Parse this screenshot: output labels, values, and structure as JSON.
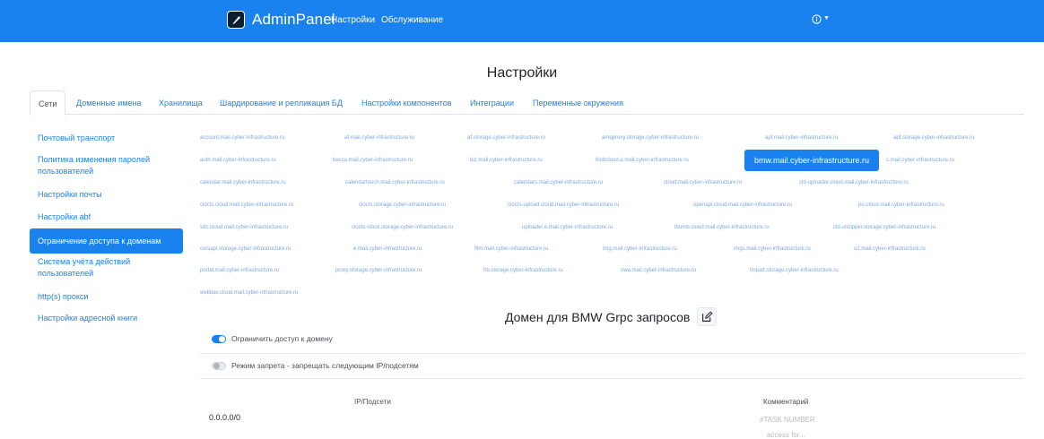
{
  "header": {
    "brand": "AdminPanel",
    "nav": [
      "Настройки",
      "Обслуживание"
    ],
    "accent": "#1a82ef"
  },
  "page": {
    "title": "Настройки"
  },
  "tabs": [
    {
      "label": "Сети",
      "active": true
    },
    {
      "label": "Доменные имена"
    },
    {
      "label": "Хранилища"
    },
    {
      "label": "Шардирование и репликация БД"
    },
    {
      "label": "Настройки компонентов"
    },
    {
      "label": "Интеграции"
    },
    {
      "label": "Переменные окружения"
    }
  ],
  "sidebar": {
    "items": [
      {
        "label": "Почтовый транспорт"
      },
      {
        "label": "Политика изменения паролей пользователей"
      },
      {
        "label": "Настройки почты"
      },
      {
        "label": "Настройки abf"
      },
      {
        "label": "Ограничение доступа к доменам",
        "active": true
      },
      {
        "label": "Система учёта действий пользователей"
      },
      {
        "label": "http(s) прокси"
      },
      {
        "label": "Настройки адресной книги"
      }
    ]
  },
  "domains": {
    "rows": [
      [
        "account.mail.cyber-infrastructure.ru",
        "af.mail.cyber-infrastructure.ru",
        "af.storage.cyber-infrastructure.ru",
        "amqproxy.storage.cyber-infrastructure.ru",
        "apf.mail.cyber-infrastructure.ru",
        "apf.storage.cyber-infrastructure.ru"
      ],
      [
        "auth.mail.cyber-infrastructure.ru",
        "becca.mail.cyber-infrastructure.ru",
        "biz.mail.cyber-infrastructure.ru",
        "blobcloud.e.mail.cyber-infrastructure.ru",
        "bmw.mail.cyber-infrastructure.ru",
        "c.mail.cyber-infrastructure.ru"
      ],
      [
        "calendar.mail.cyber-infrastructure.ru",
        "calendartouch.mail.cyber-infrastructure.ru",
        "calendars.mail.cyber-infrastructure.ru",
        "cloud.mail.cyber-infrastructure.ru",
        "cld-uploader.cloud.mail.cyber-infrastructure.ru"
      ],
      [
        "clocts.cloud.mail.cyber-infrastructure.ru",
        "clocts.storage.cyber-infrastructure.ru",
        "clocts-upload.cloud.mail.cyber-infrastructure.ru",
        "openapi.cloud.mail.cyber-infrastructure.ru",
        "pu.cloud.mail.cyber-infrastructure.ru"
      ],
      [
        "sdc.cloud.mail.cyber-infrastructure.ru",
        "clocts-stock.storage.cyber-infrastructure.ru",
        "uploader.e.mail.cyber-infrastructure.ru",
        "thumb.cloud.mail.cyber-infrastructure.ru",
        "cld-unzipper.storage.cyber-infrastructure.ru"
      ],
      [
        "corsapi.storage.cyber-infrastructure.ru",
        "e.mail.cyber-infrastructure.ru",
        "film.mail.cyber-infrastructure.ru",
        "img.mail.cyber-infrastructure.ru",
        "imgs.mail.cyber-infrastructure.ru",
        "o2.mail.cyber-infrastructure.ru"
      ],
      [
        "portal.mail.cyber-infrastructure.ru",
        "proxy.storage.cyber-infrastructure.ru",
        "hb.storage.cyber-infrastructure.ru",
        "owa.mail.cyber-infrastructure.ru",
        "tmpatt.storage.cyber-infrastructure.ru"
      ],
      [
        "webdav.cloud.mail.cyber-infrastructure.ru"
      ]
    ],
    "selected": "bmw.mail.cyber-infrastructure.ru"
  },
  "section": {
    "title": "Домен для BMW Grpc запросов",
    "restrict_label": "Ограничить доступ к домену",
    "restrict_on": true,
    "deny_label": "Режим запрета - запрещать следующим IP/подсетям",
    "deny_on": false
  },
  "table": {
    "col_ip": "IP/Подсети",
    "col_comment": "Комментарий",
    "rows": [
      {
        "ip": "0.0.0.0/0",
        "comment_placeholder_1": "#TASK NUMBER",
        "comment_placeholder_2": "access for..."
      }
    ]
  }
}
